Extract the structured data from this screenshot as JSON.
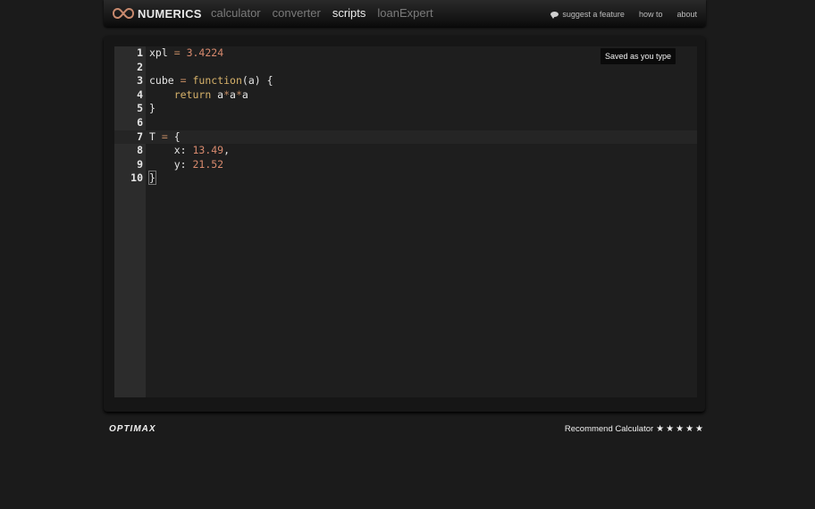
{
  "app": {
    "logo_text": "NUMERICS",
    "nav": [
      {
        "label": "calculator",
        "active": false
      },
      {
        "label": "converter",
        "active": false
      },
      {
        "label": "scripts",
        "active": true
      },
      {
        "label": "loanExpert",
        "active": false
      }
    ],
    "top_links": {
      "suggest": "suggest a feature",
      "howto": "how to",
      "about": "about"
    }
  },
  "editor": {
    "saved_badge": "Saved as you type",
    "active_line": 7,
    "lines": [
      {
        "n": "1",
        "tokens": [
          {
            "t": "xpl ",
            "c": ""
          },
          {
            "t": "=",
            "c": "op"
          },
          {
            "t": " ",
            "c": ""
          },
          {
            "t": "3.4224",
            "c": "num"
          }
        ]
      },
      {
        "n": "2",
        "tokens": []
      },
      {
        "n": "3",
        "tokens": [
          {
            "t": "cube ",
            "c": ""
          },
          {
            "t": "=",
            "c": "op"
          },
          {
            "t": " ",
            "c": ""
          },
          {
            "t": "function",
            "c": "kw"
          },
          {
            "t": "(a) {",
            "c": ""
          }
        ]
      },
      {
        "n": "4",
        "tokens": [
          {
            "t": "    ",
            "c": ""
          },
          {
            "t": "return",
            "c": "kw"
          },
          {
            "t": " a",
            "c": ""
          },
          {
            "t": "*",
            "c": "op"
          },
          {
            "t": "a",
            "c": ""
          },
          {
            "t": "*",
            "c": "op"
          },
          {
            "t": "a",
            "c": ""
          }
        ]
      },
      {
        "n": "5",
        "tokens": [
          {
            "t": "}",
            "c": ""
          }
        ]
      },
      {
        "n": "6",
        "tokens": []
      },
      {
        "n": "7",
        "tokens": [
          {
            "t": "T ",
            "c": ""
          },
          {
            "t": "=",
            "c": "op"
          },
          {
            "t": " {",
            "c": ""
          }
        ]
      },
      {
        "n": "8",
        "tokens": [
          {
            "t": "    x: ",
            "c": ""
          },
          {
            "t": "13.49",
            "c": "num"
          },
          {
            "t": ",",
            "c": ""
          }
        ]
      },
      {
        "n": "9",
        "tokens": [
          {
            "t": "    y: ",
            "c": ""
          },
          {
            "t": "21.52",
            "c": "num"
          }
        ]
      },
      {
        "n": "10",
        "tokens": [
          {
            "t": "}",
            "c": "cursor"
          }
        ]
      }
    ]
  },
  "footer": {
    "brand": "OPTIMAX",
    "recommend": "Recommend Calculator",
    "stars": [
      "★",
      "★",
      "★",
      "★",
      "★"
    ]
  },
  "colors": {
    "background": "#1b1b1b",
    "number": "#d88a6e",
    "keyword": "#d7b26a",
    "operator": "#c28a62"
  }
}
